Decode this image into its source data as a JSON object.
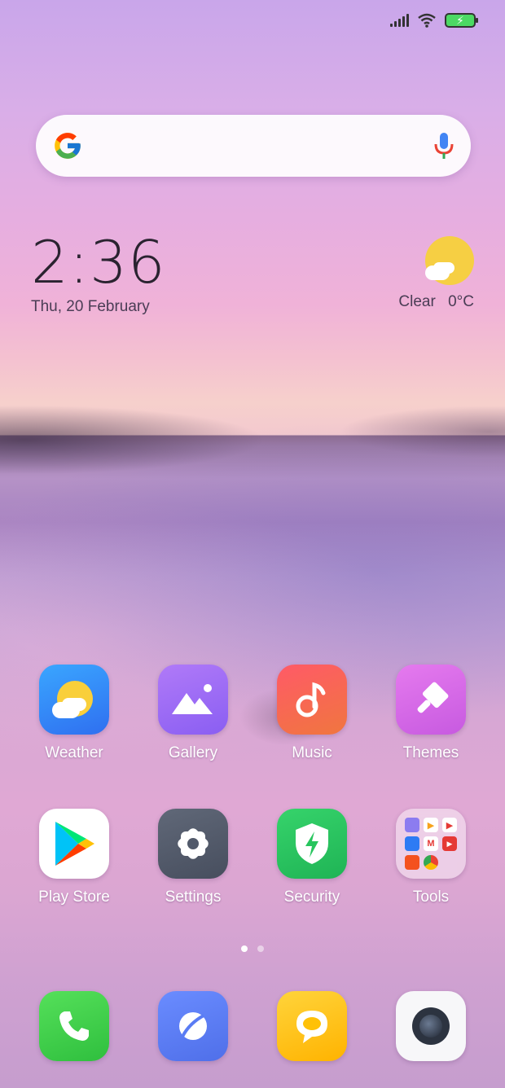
{
  "clock": {
    "time": "2:36",
    "date": "Thu, 20 February"
  },
  "weather_widget": {
    "condition": "Clear",
    "temperature": "0°C"
  },
  "apps": [
    {
      "label": "Weather",
      "icon": "weather-icon"
    },
    {
      "label": "Gallery",
      "icon": "gallery-icon"
    },
    {
      "label": "Music",
      "icon": "music-icon"
    },
    {
      "label": "Themes",
      "icon": "themes-icon"
    },
    {
      "label": "Play Store",
      "icon": "play-store-icon"
    },
    {
      "label": "Settings",
      "icon": "settings-icon"
    },
    {
      "label": "Security",
      "icon": "security-icon"
    },
    {
      "label": "Tools",
      "icon": "tools-folder-icon"
    }
  ],
  "dock": [
    {
      "icon": "phone-icon"
    },
    {
      "icon": "browser-icon"
    },
    {
      "icon": "messages-icon"
    },
    {
      "icon": "camera-icon"
    }
  ],
  "page_indicator": {
    "current": 1,
    "total": 2
  },
  "colors": {
    "weather": "#2f8cf5",
    "gallery": "#9a6bf6",
    "music": "#f2465a",
    "themes": "#d86ae6",
    "settings": "#525a6b",
    "security": "#27c55d",
    "phone": "#3ecf48",
    "browser": "#5a7cf4",
    "messages": "#ffc107"
  }
}
